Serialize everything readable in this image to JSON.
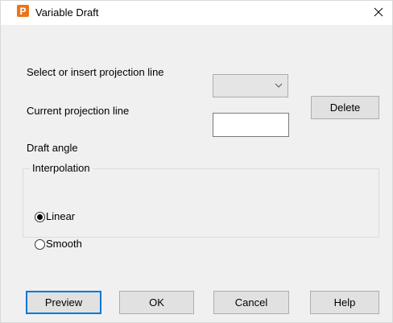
{
  "window": {
    "title": "Variable Draft",
    "app_icon_letter": "P",
    "app_icon_color": "#e8761c",
    "close_glyph": "✕"
  },
  "dialog": {
    "instruction": "Select or insert projection line",
    "projection_line_label": "Current projection line",
    "projection_line_value": "",
    "delete_label": "Delete",
    "draft_angle_label": "Draft angle",
    "draft_angle_value": "",
    "interpolation": {
      "title": "Interpolation",
      "options": [
        {
          "label": "Linear",
          "selected": true
        },
        {
          "label": "Smooth",
          "selected": false
        }
      ]
    }
  },
  "footer": {
    "preview_label": "Preview",
    "ok_label": "OK",
    "cancel_label": "Cancel",
    "help_label": "Help"
  },
  "colors": {
    "focus_border": "#0078d7",
    "dialog_background": "#f0f0f0"
  }
}
